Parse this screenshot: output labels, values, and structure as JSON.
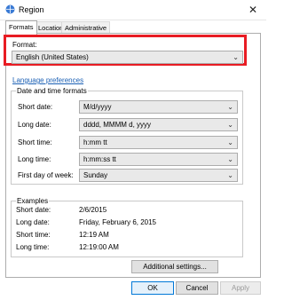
{
  "window": {
    "title": "Region"
  },
  "tabs": [
    "Formats",
    "Location",
    "Administrative"
  ],
  "format": {
    "label": "Format:",
    "value": "English (United States)"
  },
  "link": "Language preferences",
  "date_time": {
    "label": "Date and time formats",
    "rows": [
      {
        "label": "Short date:",
        "value": "M/d/yyyy"
      },
      {
        "label": "Long date:",
        "value": "dddd, MMMM d, yyyy"
      },
      {
        "label": "Short time:",
        "value": "h:mm tt"
      },
      {
        "label": "Long time:",
        "value": "h:mm:ss tt"
      },
      {
        "label": "First day of week:",
        "value": "Sunday"
      }
    ]
  },
  "examples": {
    "label": "Examples",
    "rows": [
      {
        "label": "Short date:",
        "value": "2/6/2015"
      },
      {
        "label": "Long date:",
        "value": "Friday, February 6, 2015"
      },
      {
        "label": "Short time:",
        "value": "12:19 AM"
      },
      {
        "label": "Long time:",
        "value": "12:19:00 AM"
      }
    ]
  },
  "buttons": {
    "additional": "Additional settings...",
    "ok": "OK",
    "cancel": "Cancel",
    "apply": "Apply"
  },
  "colors": {
    "highlight": "#e81c23",
    "link": "#1a5fb4",
    "primary_border": "#0078d7"
  },
  "icons": {
    "app": "region-globe-icon",
    "close": "close-icon",
    "dropdown": "chevron-down-icon"
  }
}
